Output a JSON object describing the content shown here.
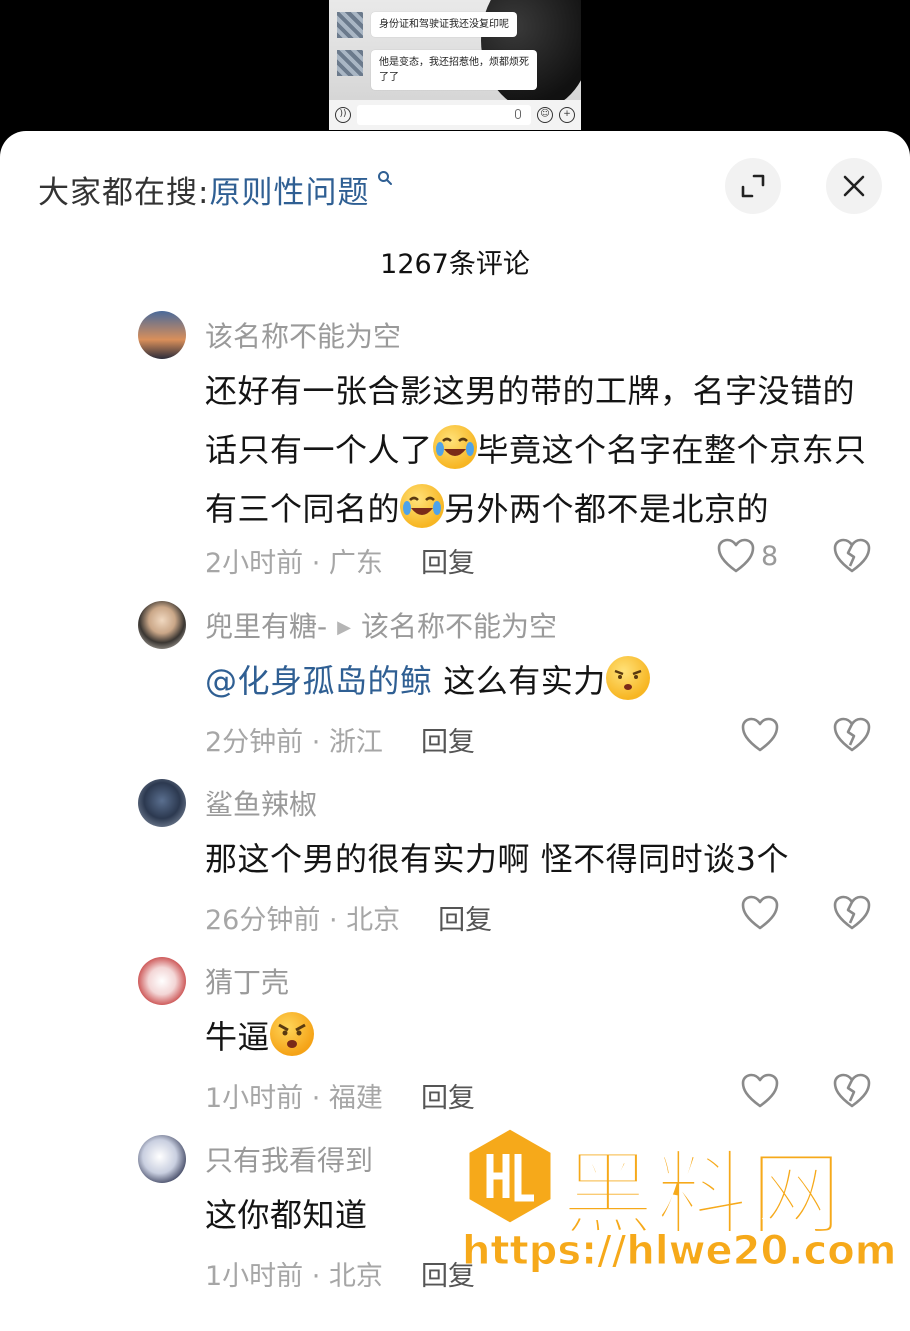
{
  "video": {
    "chat": [
      {
        "text": "身份证和驾驶证我还没复印呢"
      },
      {
        "text": "他是变态，我还招惹他，烦都烦死了了"
      }
    ]
  },
  "header": {
    "search_prefix": "大家都在搜:",
    "search_term": "原则性问题",
    "search_icon": "search-icon",
    "expand_icon": "expand-icon",
    "close_icon": "close-icon"
  },
  "comment_count": "1267条评论",
  "comments": [
    {
      "user": "该名称不能为空",
      "text_parts": [
        "还好有一张合影这男的带的工牌，名字没错的话只有一个人了",
        "毕竟这个名字在整个京东只有三个同名的",
        "另外两个都不是北京的"
      ],
      "emoji": "tears-of-joy-emoji",
      "time_loc": "2小时前 · 广东",
      "reply": "回复",
      "likes": "8"
    },
    {
      "user": "兜里有糖-",
      "reply_to": "该名称不能为空",
      "mention": "@化身孤岛的鲸",
      "text": "这么有实力",
      "emoji": "unamused-emoji",
      "time_loc": "2分钟前 · 浙江",
      "reply": "回复",
      "likes": ""
    },
    {
      "user": "鲨鱼辣椒",
      "text": "那这个男的很有实力啊 怪不得同时谈3个",
      "time_loc": "26分钟前 · 北京",
      "reply": "回复",
      "likes": ""
    },
    {
      "user": "猜丁壳",
      "text": "牛逼",
      "emoji": "angry-emoji",
      "time_loc": "1小时前 · 福建",
      "reply": "回复",
      "likes": ""
    },
    {
      "user": "只有我看得到",
      "text": "这你都知道",
      "time_loc": "1小时前 · 北京",
      "reply": "回复",
      "likes": ""
    }
  ],
  "watermark": {
    "title": "黑料网",
    "url": "https://hlwe20.com"
  }
}
